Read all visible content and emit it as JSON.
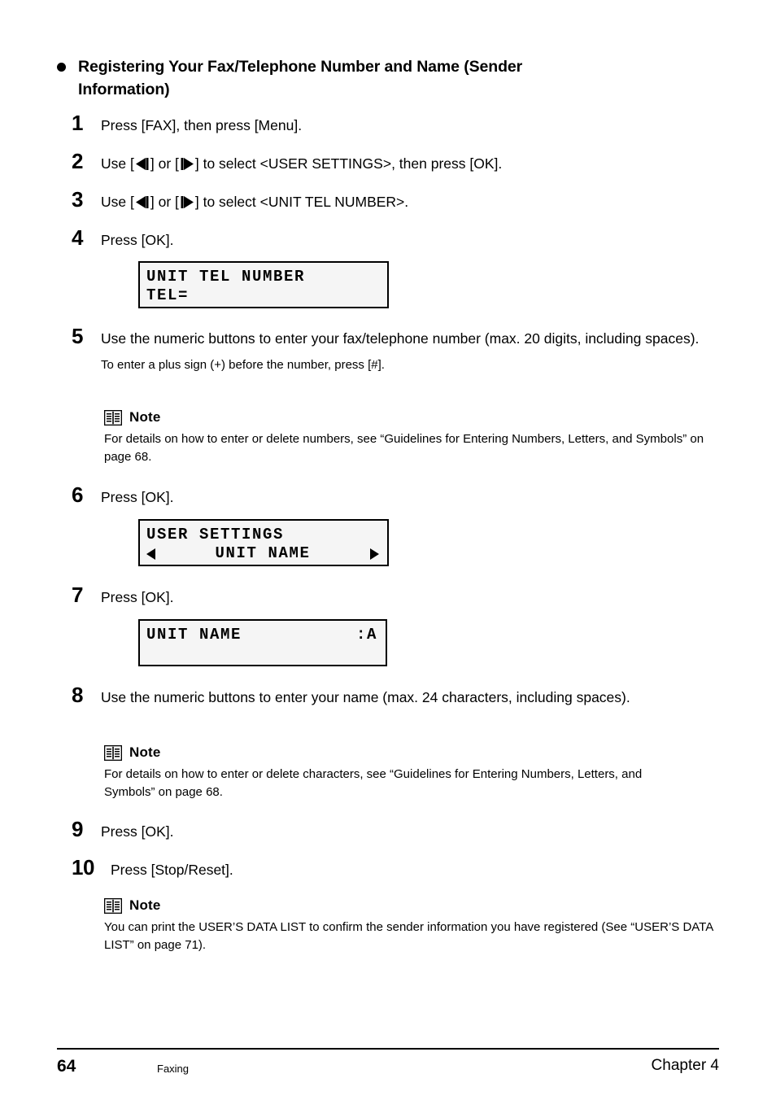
{
  "heading": {
    "bullet": "bullet-dot",
    "text": "Registering Your Fax/Telephone Number and Name (Sender Information)"
  },
  "steps": [
    {
      "num": "1",
      "text_before": "Press [FAX], then press [Menu].",
      "text_after": ""
    },
    {
      "num": "2",
      "text_before": "Use [",
      "text_mid": "] or [",
      "text_after": "] to select <USER SETTINGS>, then press [OK]."
    },
    {
      "num": "3",
      "text_before": "Use [",
      "text_mid": "] or [",
      "text_after": "] to select <UNIT TEL NUMBER>."
    },
    {
      "num": "4",
      "text_before": "Press [OK].",
      "text_after": ""
    },
    {
      "num": "5",
      "text_before": "Use the numeric buttons to enter your fax/telephone number (max. 20 digits, including spaces).",
      "sub": "To enter a plus sign (+) before the number, press [#]."
    },
    {
      "num": "6",
      "text_before": "Press [OK].",
      "text_after": ""
    },
    {
      "num": "7",
      "text_before": "Press [OK].",
      "text_after": ""
    },
    {
      "num": "8",
      "text_before": "Use the numeric buttons to enter your name (max. 24 characters, including spaces).",
      "text_after": ""
    },
    {
      "num": "9",
      "text_before": "Press [OK].",
      "text_after": ""
    },
    {
      "num": "10",
      "text_before": "Press [Stop/Reset].",
      "text_after": ""
    }
  ],
  "lcd_displays": [
    {
      "id": "unit-tel-number",
      "line1": "UNIT TEL NUMBER",
      "line2": "TEL="
    },
    {
      "id": "user-settings",
      "line1": "USER SETTINGS",
      "line2_center": "UNIT NAME",
      "left_arrow": "left-triangle-icon",
      "right_arrow": "right-triangle-icon"
    },
    {
      "id": "unit-name",
      "line1_left": "UNIT NAME",
      "line1_right": ":A",
      "line2": ""
    }
  ],
  "notes": [
    {
      "icon": "open-book-icon",
      "title": "Note",
      "body": "For details on how to enter or delete numbers, see “Guidelines for Entering Numbers, Letters, and Symbols” on page 68."
    },
    {
      "icon": "open-book-icon",
      "title": "Note",
      "body": "For details on how to enter or delete characters, see “Guidelines for Entering Numbers, Letters, and Symbols” on page 68."
    },
    {
      "icon": "open-book-icon",
      "title": "Note",
      "body": "You can print the USER’S DATA LIST to confirm the sender information you have registered (See “USER’S DATA LIST” on page 71)."
    }
  ],
  "footer": {
    "page_number": "64",
    "section": "Faxing",
    "chapter": "Chapter 4"
  },
  "colors": {
    "text": "#000000",
    "page_background": "#ffffff",
    "lcd_background": "#f5f5f5",
    "lcd_border": "#000000"
  }
}
